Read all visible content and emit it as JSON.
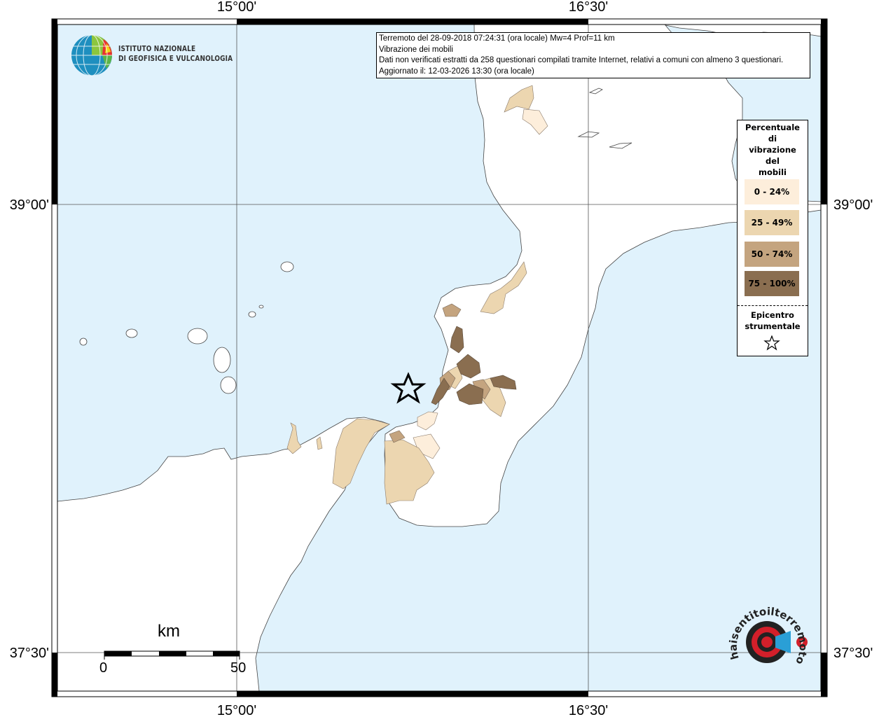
{
  "info": {
    "line1": "Terremoto del 28-09-2018 07:24:31 (ora locale) Mw=4 Prof=11 km",
    "line2": "Vibrazione dei mobili",
    "line3": "Dati non verificati estratti da 258 questionari compilati tramite Internet, relativi a comuni con almeno 3 questionari.",
    "line4": "Aggiornato il: 12-03-2026 13:30 (ora locale)"
  },
  "axes": {
    "top_left": "15°00'",
    "top_right": "16°30'",
    "bottom_left": "15°00'",
    "bottom_right": "16°30'",
    "left_top": "39°00'",
    "left_bottom": "37°30'",
    "right_top": "39°00'",
    "right_bottom": "37°30'"
  },
  "legend": {
    "title": [
      "Percentuale",
      "di",
      "vibrazione",
      "del",
      "mobili"
    ],
    "classes": [
      {
        "label": "0 - 24%",
        "color": "#fdeedb"
      },
      {
        "label": "25 - 49%",
        "color": "#ecd6b0"
      },
      {
        "label": "50 - 74%",
        "color": "#c4a47f"
      },
      {
        "label": "75 - 100%",
        "color": "#8a6e50"
      }
    ],
    "epicenter_label": [
      "Epicentro",
      "strumentale"
    ]
  },
  "scale": {
    "unit": "km",
    "start": "0",
    "end": "50"
  },
  "logos": {
    "ingv": [
      "ISTITUTO NAZIONALE",
      "DI GEOFISICA E VULCANOLOGIA"
    ],
    "hst": "haisentitoilterremoto.it"
  },
  "colors": {
    "sea": "#e0f2fc",
    "land": "#ffffff",
    "frame": "#000000"
  }
}
